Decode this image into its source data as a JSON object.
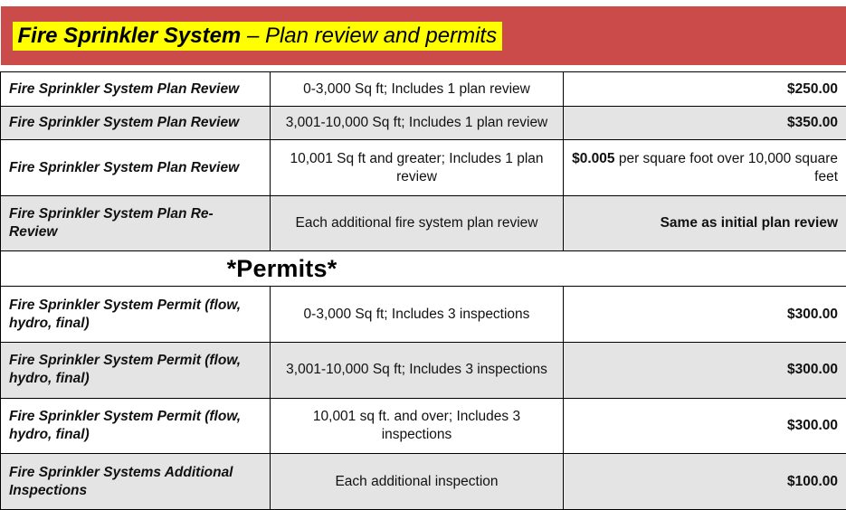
{
  "document": {
    "title_strong": "Fire Sprinkler System",
    "title_rest": " – Plan review and permits",
    "banner_color": "#cb4a4a",
    "highlight_color": "#ffff00",
    "shaded_row_color": "#e4e4e4",
    "border_color": "#000000"
  },
  "sections": [
    {
      "name": "plan-review",
      "rows": [
        {
          "service": "Fire Sprinkler System Plan Review",
          "description": "0-3,000 Sq ft; Includes 1 plan review",
          "fee": "$250.00",
          "fee_note": "",
          "shaded": false
        },
        {
          "service": "Fire Sprinkler System Plan Review",
          "description": "3,001-10,000 Sq ft; Includes 1 plan review",
          "fee": "$350.00",
          "fee_note": "",
          "shaded": true
        },
        {
          "service": "Fire Sprinkler System Plan Review",
          "description": "10,001 Sq ft and greater; Includes 1 plan review",
          "fee": "$0.005",
          "fee_note": " per square foot over 10,000 square feet",
          "shaded": false
        },
        {
          "service": "Fire Sprinkler System Plan Re-Review",
          "description": "Each additional fire system plan review",
          "fee": "Same as initial plan review",
          "fee_note": "",
          "shaded": true
        }
      ]
    },
    {
      "name": "permits",
      "heading": "*Permits*",
      "rows": [
        {
          "service": "Fire Sprinkler System Permit (flow, hydro, final)",
          "description": "0-3,000 Sq ft; Includes 3 inspections",
          "fee": "$300.00",
          "fee_note": "",
          "shaded": false
        },
        {
          "service": "Fire Sprinkler System Permit (flow, hydro, final)",
          "description": "3,001-10,000 Sq ft; Includes 3 inspections",
          "fee": "$300.00",
          "fee_note": "",
          "shaded": true
        },
        {
          "service": "Fire Sprinkler System Permit (flow, hydro, final)",
          "description": "10,001 sq ft. and over; Includes 3 inspections",
          "fee": "$300.00",
          "fee_note": "",
          "shaded": false
        },
        {
          "service": "Fire Sprinkler Systems Additional Inspections",
          "description": "Each additional inspection",
          "fee": "$100.00",
          "fee_note": "",
          "shaded": true
        }
      ]
    }
  ]
}
